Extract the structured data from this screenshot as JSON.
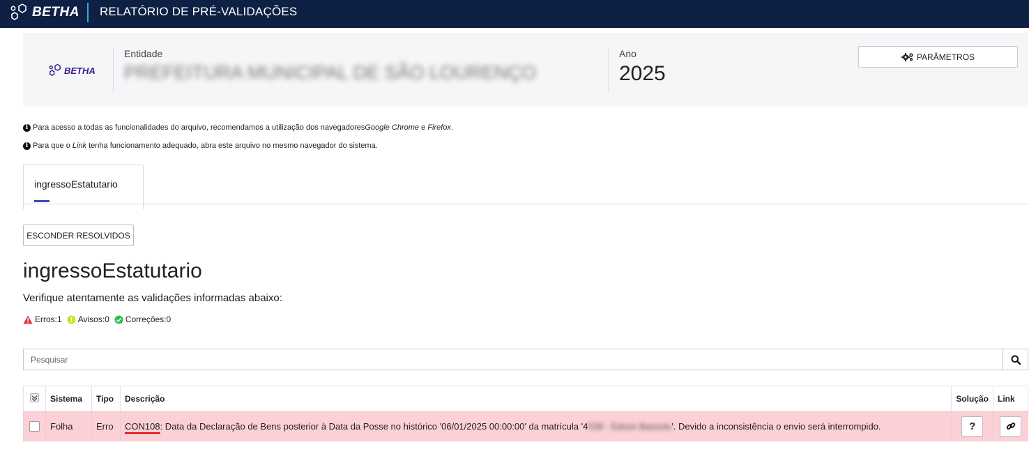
{
  "topbar": {
    "brand": "BETHA",
    "title": "RELATÓRIO DE PRÉ-VALIDAÇÕES"
  },
  "header": {
    "brand": "BETHA",
    "entidade_label": "Entidade",
    "entidade_value": "PREFEITURA MUNICIPAL DE SÃO LOURENÇO",
    "ano_label": "Ano",
    "ano_value": "2025",
    "param_button": "PARÂMETROS"
  },
  "notes": {
    "n1_a": "Para acesso a todas as funcionalidades do arquivo, recomendamos a utilização dos navegadores ",
    "n1_b": "Google Chrome",
    "n1_c": " e ",
    "n1_d": "Firefox",
    "n1_e": ".",
    "n2_a": "Para que o ",
    "n2_b": "Link",
    "n2_c": " tenha funcionamento adequado, abra este arquivo no mesmo navegador do sistema."
  },
  "tabs": [
    {
      "label": "ingressoEstatutario"
    }
  ],
  "hide_resolved_button": "ESCONDER RESOLVIDOS",
  "section": {
    "title": "ingressoEstatutario",
    "subtitle": "Verifique atentamente as validações informadas abaixo:"
  },
  "counts": {
    "erros": "Erros:1",
    "avisos": "Avisos:0",
    "correcoes": "Correções:0"
  },
  "colors": {
    "erro": "#e8303e",
    "aviso": "#c9e32a",
    "correcao": "#2fbf4f",
    "row_bg": "#fbd0d6",
    "topbar": "#0e2144"
  },
  "search": {
    "placeholder": "Pesquisar"
  },
  "table": {
    "headers": {
      "sistema": "Sistema",
      "tipo": "Tipo",
      "descricao": "Descrição",
      "solucao": "Solução",
      "link": "Link"
    },
    "rows": [
      {
        "sistema": "Folha",
        "tipo": "Erro",
        "code": "CON108",
        "desc_a": ": Data da Declaração de Bens posterior à Data da Posse no histórico '06/01/2025 00:00:00' da matrícula '4",
        "desc_hidden": "538 - Edson Bassolo",
        "desc_b": "'. Devido a inconsistência o envio será interrompido.",
        "solucao_btn": "?"
      }
    ]
  }
}
